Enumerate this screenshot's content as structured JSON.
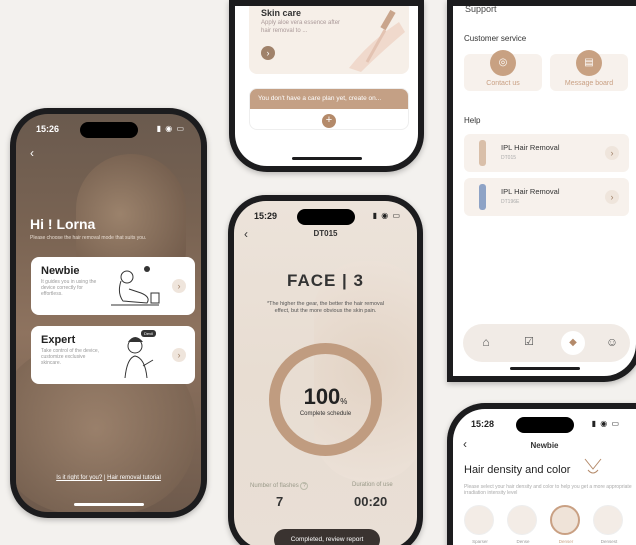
{
  "phone_a": {
    "time": "15:26",
    "greeting": "Hi ! Lorna",
    "subtitle": "Please choose the hair removal mode that suits you.",
    "newbie": {
      "title": "Newbie",
      "desc": "It guides you in using the device correctly for effortless."
    },
    "expert": {
      "title": "Expert",
      "desc": "Take control of the device, customize exclusive skincare.",
      "badge": "Devil"
    },
    "footer_link1": "Is it right for you?",
    "footer_sep": "|",
    "footer_link2": "Hair removal tutorial"
  },
  "phone_b": {
    "card_title": "Skin care",
    "card_desc": "Apply aloe vera essence after hair removal to ...",
    "banner": "You don't have a care plan yet, create on..."
  },
  "phone_c": {
    "time": "15:29",
    "title": "DT015",
    "face": "FACE | 3",
    "note": "*The higher the gear, the better the hair removal effect, but the more obvious the skin pain.",
    "percent": "100",
    "percent_unit": "%",
    "progress_label": "Complete schedule",
    "progress": 1.0,
    "flashes_label": "Number of flashes",
    "flashes": "7",
    "duration_label": "Duration of use",
    "duration": "00:20",
    "button": "Completed, review report"
  },
  "phone_d": {
    "section_top": "Support",
    "customer_service": "Customer service",
    "contact": "Contact us",
    "message": "Message board",
    "help": "Help",
    "devices": [
      {
        "name": "IPL Hair Removal",
        "model": "DT015"
      },
      {
        "name": "IPL Hair Removal",
        "model": "DT196E"
      }
    ]
  },
  "phone_e": {
    "time": "15:28",
    "nav_title": "Newbie",
    "heading": "Hair density and color",
    "desc": "Please select your hair density and color to help you get a more appropriate irradiation intensity level",
    "options": [
      "Sparser",
      "Dense",
      "Denser",
      "Densest"
    ]
  },
  "colors": {
    "accent": "#b48a6a",
    "accent_light": "#efe3d8"
  }
}
